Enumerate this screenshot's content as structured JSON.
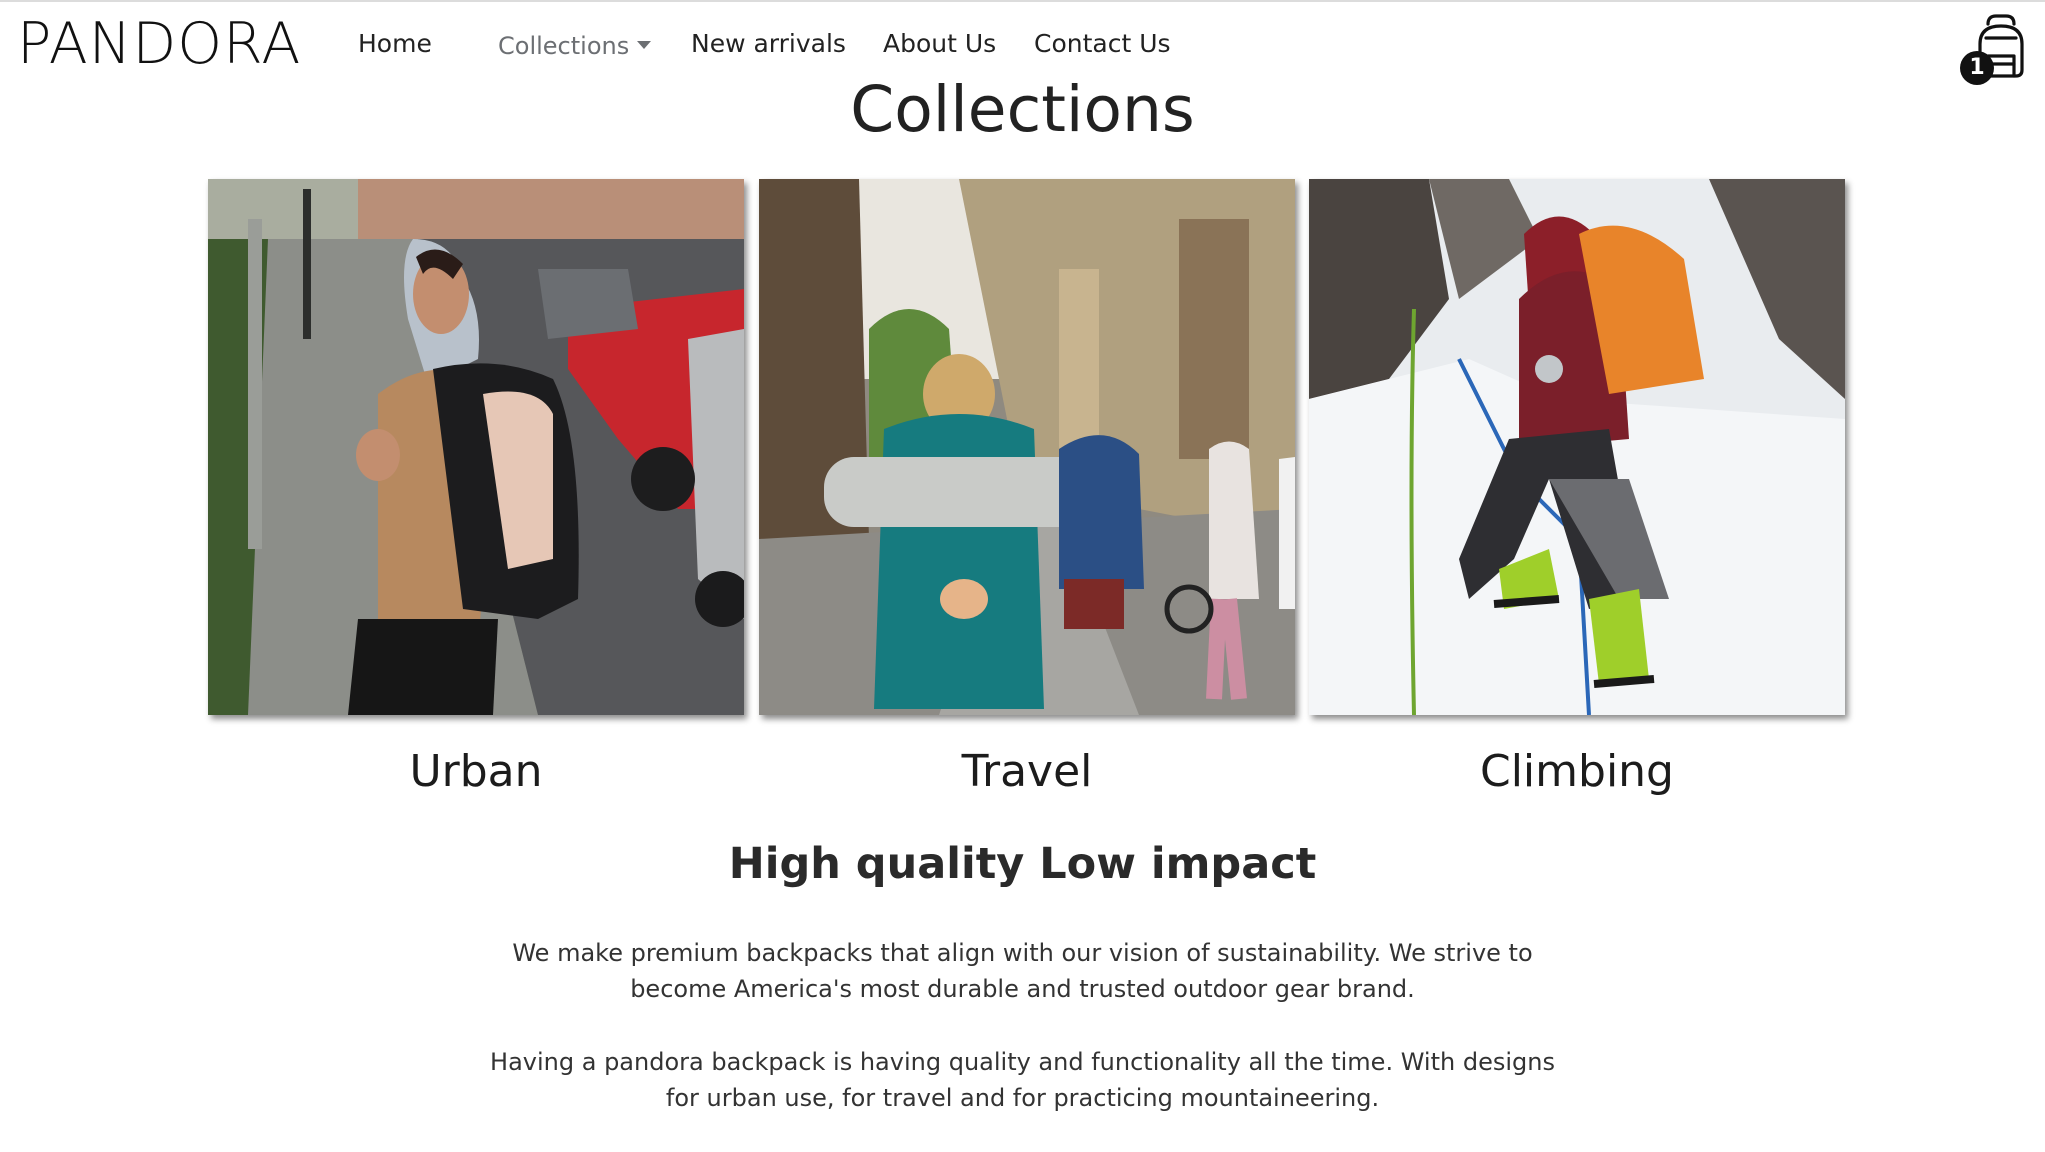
{
  "brand": "PANDORA",
  "nav": {
    "home": "Home",
    "collections": "Collections",
    "new_arrivals": "New arrivals",
    "about": "About Us",
    "contact": "Contact Us"
  },
  "cart": {
    "icon": "backpack-icon",
    "count": "1"
  },
  "page_title": "Collections",
  "collections": [
    {
      "label": "Urban",
      "image": "urban-backpack-photo"
    },
    {
      "label": "Travel",
      "image": "travel-backpack-photo"
    },
    {
      "label": "Climbing",
      "image": "climbing-backpack-photo"
    }
  ],
  "tagline": "High quality Low impact",
  "paragraphs": [
    "We make premium backpacks that align with our vision of sustainability. We strive to become America's most durable and trusted outdoor gear brand.",
    "Having a pandora backpack is having quality and functionality all the time. With designs for urban use, for travel and for practicing mountaineering."
  ]
}
